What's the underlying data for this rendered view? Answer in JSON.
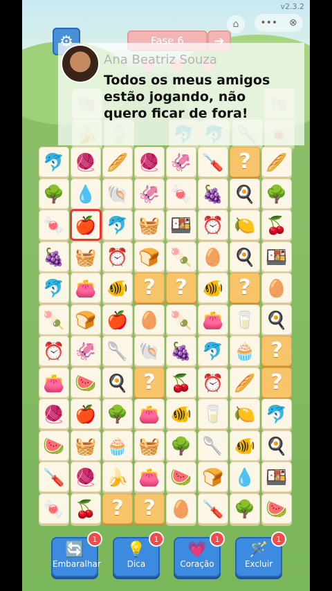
{
  "app": {
    "version": "v2.3.2"
  },
  "header": {
    "level_label": "Fase 6",
    "next_icon": "arrow-right-icon",
    "settings_icon": "gear-icon",
    "hearts": [
      "♥",
      "♥",
      "♥"
    ]
  },
  "chat": {
    "username": "Ana Beatriz Souza",
    "message": "Todos os meus amigos estão jogando, não quero ficar de fora!"
  },
  "preview_tiles": [
    "🐚",
    "🍌",
    "🥛",
    "🐬",
    "🐬",
    "🥄",
    "🍬",
    "🐚"
  ],
  "board": {
    "rows": [
      [
        "🐬",
        "🧶",
        "🥖",
        "🧶",
        "🦑",
        "🪛",
        "?",
        "🥖"
      ],
      [
        "🌳",
        "💧",
        "🐚",
        "🦑",
        "🍬",
        "🍇",
        "🍳",
        "🌳"
      ],
      [
        "🍬",
        "🍎",
        "🐬",
        "🧺",
        "🍱",
        "⏰",
        "🍋",
        "🍒"
      ],
      [
        "🍇",
        "🧺",
        "⏰",
        "🍞",
        "🍡",
        "🥚",
        "🍳",
        "🍱"
      ],
      [
        "🐬",
        "👛",
        "🐠",
        "?",
        "?",
        "🐠",
        "?",
        "🥚"
      ],
      [
        "🍡",
        "🍞",
        "🍎",
        "🥚",
        "🍡",
        "👛",
        "🥛",
        "🍳"
      ],
      [
        "⏰",
        "🦑",
        "🥄",
        "🐚",
        "🍇",
        "🐬",
        "🧁",
        "?"
      ],
      [
        "👛",
        "🍉",
        "🍳",
        "?",
        "🍒",
        "⏰",
        "🥖",
        "?"
      ],
      [
        "🧶",
        "🍎",
        "🌳",
        "👛",
        "🐠",
        "🥛",
        "🍋",
        "🐬"
      ],
      [
        "🍉",
        "🧺",
        "🧁",
        "🧺",
        "🌳",
        "🥄",
        "🐠",
        "🍳"
      ],
      [
        "🪛",
        "🧶",
        "🍌",
        "👛",
        "🍉",
        "🍞",
        "💧",
        "🍱"
      ],
      [
        "🍬",
        "🍒",
        "?",
        "?",
        "🥚",
        "🪛",
        "🌳",
        "🍉"
      ]
    ]
  },
  "powerups": [
    {
      "label": "Embaralhar",
      "icon": "🔄",
      "count": "1"
    },
    {
      "label": "Dica",
      "icon": "💡",
      "count": "1"
    },
    {
      "label": "Coração",
      "icon": "💗",
      "count": "1"
    },
    {
      "label": "Excluir",
      "icon": "🪄",
      "count": "1"
    }
  ],
  "colors": {
    "tile": "#fbf6e6",
    "hidden_tile": "#f7c46a",
    "powerup": "#3d8be0",
    "badge": "#f04a4a"
  }
}
